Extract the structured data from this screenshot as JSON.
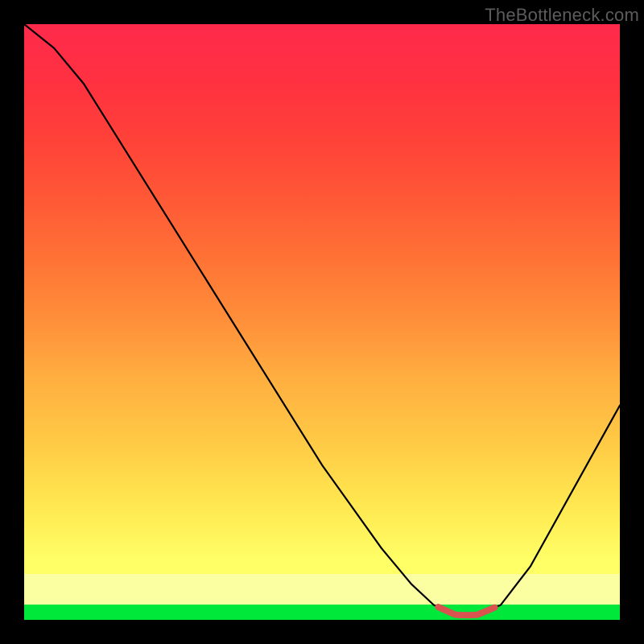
{
  "watermark": "TheBottleneck.com",
  "colors": {
    "background": "#000000",
    "curve": "#000000",
    "highlight": "#d9534f",
    "gradient_stops": [
      "#00e83a",
      "#fbffa2",
      "#ffff66",
      "#ffe64f",
      "#ffc945",
      "#ffb040",
      "#ff903a",
      "#ff7435",
      "#ff5a36",
      "#ff4338",
      "#ff3140",
      "#ff2a4b"
    ]
  },
  "chart_data": {
    "type": "line",
    "title": "",
    "xlabel": "",
    "ylabel": "",
    "x": [
      0.0,
      0.05,
      0.1,
      0.15,
      0.2,
      0.25,
      0.3,
      0.35,
      0.4,
      0.45,
      0.5,
      0.55,
      0.6,
      0.65,
      0.6875,
      0.725,
      0.76,
      0.8,
      0.85,
      0.9,
      0.95,
      1.0
    ],
    "values": [
      1.0,
      0.96,
      0.9,
      0.82,
      0.74,
      0.66,
      0.58,
      0.5,
      0.42,
      0.34,
      0.26,
      0.19,
      0.12,
      0.06,
      0.025,
      0.008,
      0.008,
      0.025,
      0.09,
      0.18,
      0.27,
      0.36
    ],
    "xlim": [
      0,
      1
    ],
    "ylim": [
      0,
      1
    ],
    "highlight_segment": {
      "x_start": 0.695,
      "x_end": 0.79
    }
  }
}
